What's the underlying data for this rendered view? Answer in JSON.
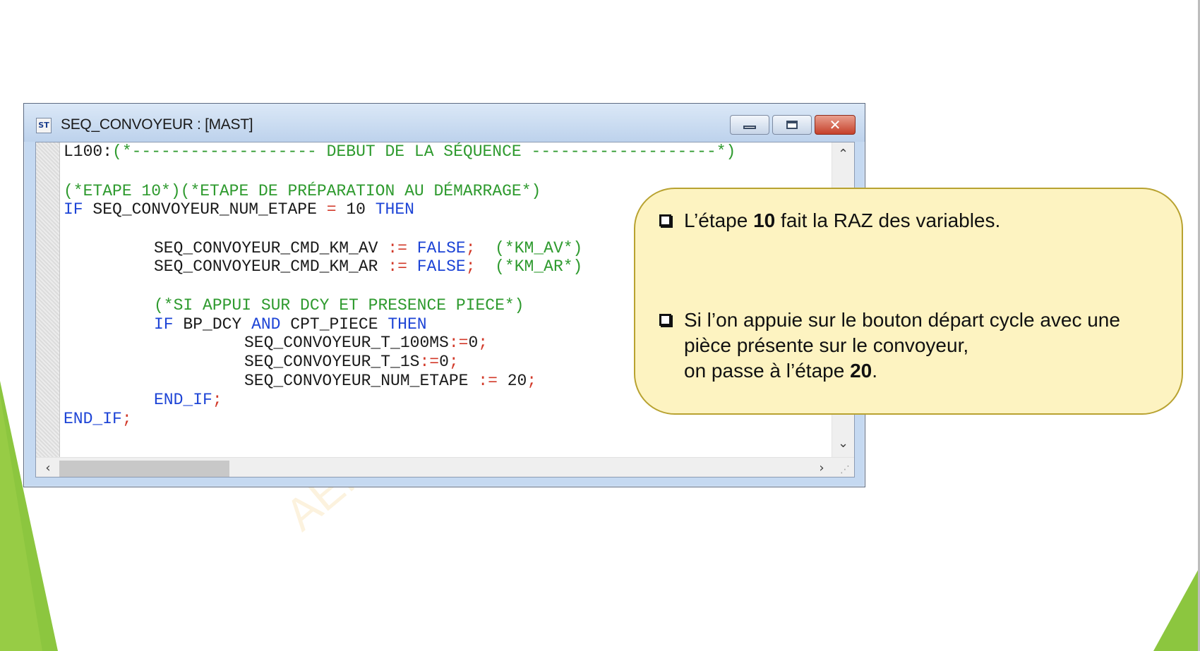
{
  "window": {
    "title": "SEQ_CONVOYEUR : [MAST]",
    "icon_label": "ST",
    "icon": "structured-text-icon"
  },
  "code": {
    "line1": {
      "label": "L100:",
      "comment": "(*------------------- DEBUT DE LA SÉQUENCE -------------------*)"
    },
    "line3": {
      "c1": "(*ETAPE 10*)",
      "c2": "(*ETAPE DE PRÉPARATION AU DÉMARRAGE*)"
    },
    "line4": {
      "kw_if": "IF",
      "var": "SEQ_CONVOYEUR_NUM_ETAPE",
      "op": "=",
      "num": "10",
      "kw_then": "THEN"
    },
    "line6": {
      "var": "SEQ_CONVOYEUR_CMD_KM_AV",
      "op": ":=",
      "val": "FALSE",
      "semi": ";",
      "comment": "(*KM_AV*)"
    },
    "line7": {
      "var": "SEQ_CONVOYEUR_CMD_KM_AR",
      "op": ":=",
      "val": "FALSE",
      "semi": ";",
      "comment": "(*KM_AR*)"
    },
    "line9": {
      "comment": "(*SI APPUI SUR DCY ET PRESENCE PIECE*)"
    },
    "line10": {
      "kw_if": "IF",
      "var1": "BP_DCY",
      "kw_and": "AND",
      "var2": "CPT_PIECE",
      "kw_then": "THEN"
    },
    "line11": {
      "var": "SEQ_CONVOYEUR_T_100MS",
      "op": ":=",
      "num": "0",
      "semi": ";"
    },
    "line12": {
      "var": "SEQ_CONVOYEUR_T_1S",
      "op": ":=",
      "num": "0",
      "semi": ";"
    },
    "line13": {
      "var": "SEQ_CONVOYEUR_NUM_ETAPE",
      "op": ":=",
      "num": "20",
      "semi": ";"
    },
    "line14": {
      "kw": "END_IF",
      "semi": ";"
    },
    "line15": {
      "kw": "END_IF",
      "semi": ";"
    }
  },
  "callout": {
    "bullet1": {
      "pre": "L’étape ",
      "bold": "10",
      "post": " fait la RAZ des variables."
    },
    "bullet2": {
      "line1": "Si l’on appuie sur le bouton départ cycle avec une",
      "line2": "pièce présente sur le convoyeur,",
      "line3_pre": "on passe à l’étape ",
      "line3_bold": "20",
      "line3_post": "."
    }
  },
  "watermark": "AEI",
  "colors": {
    "keyword": "#1d44d6",
    "comment": "#2e9a2e",
    "operator": "#d23a2a",
    "callout_bg": "#fdf3c1",
    "callout_border": "#b8a230",
    "decoration": "#8cc63f"
  }
}
